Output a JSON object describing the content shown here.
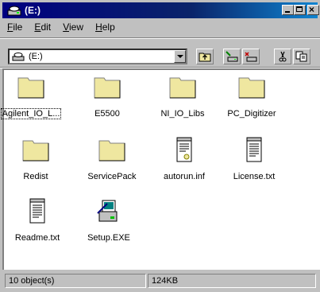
{
  "window": {
    "title": "(E:)"
  },
  "menu": {
    "items": [
      {
        "label": "File",
        "u": "F",
        "rest": "ile"
      },
      {
        "label": "Edit",
        "u": "E",
        "rest": "dit"
      },
      {
        "label": "View",
        "u": "V",
        "rest": "iew"
      },
      {
        "label": "Help",
        "u": "H",
        "rest": "elp"
      }
    ]
  },
  "address": {
    "value": "(E:)"
  },
  "items": [
    {
      "label": "Agilent_IO_L...",
      "type": "folder"
    },
    {
      "label": "E5500",
      "type": "folder"
    },
    {
      "label": "NI_IO_Libs",
      "type": "folder"
    },
    {
      "label": "PC_Digitizer",
      "type": "folder"
    },
    {
      "label": "Redist",
      "type": "folder"
    },
    {
      "label": "ServicePack",
      "type": "folder"
    },
    {
      "label": "autorun.inf",
      "type": "settings-file"
    },
    {
      "label": "License.txt",
      "type": "text-file"
    },
    {
      "label": "Readme.txt",
      "type": "text-file"
    },
    {
      "label": "Setup.EXE",
      "type": "setup-exe"
    }
  ],
  "status": {
    "count": "10 object(s)",
    "size": "124KB"
  },
  "colors": {
    "titlebar": "#000080",
    "folder": "#efe7a0",
    "face": "#c0c0c0"
  }
}
